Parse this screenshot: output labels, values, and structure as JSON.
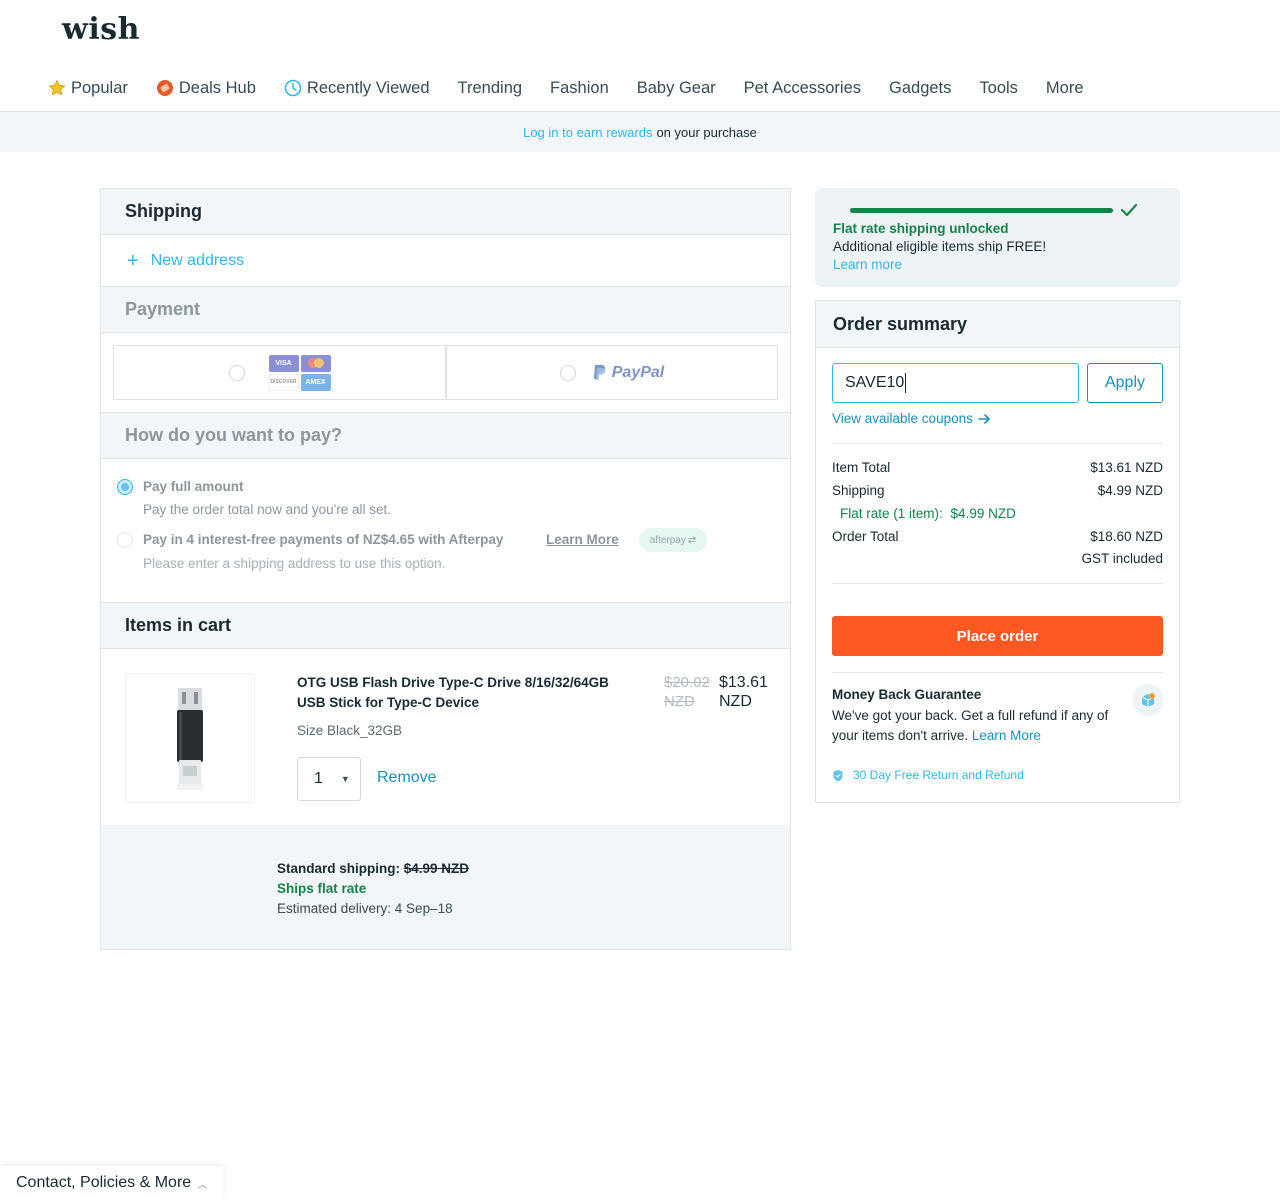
{
  "header": {
    "logo": "wish",
    "nav": [
      {
        "label": "Popular",
        "icon": "star-icon"
      },
      {
        "label": "Deals Hub",
        "icon": "deals-tag-icon"
      },
      {
        "label": "Recently Viewed",
        "icon": "clock-icon"
      },
      {
        "label": "Trending"
      },
      {
        "label": "Fashion"
      },
      {
        "label": "Baby Gear"
      },
      {
        "label": "Pet Accessories"
      },
      {
        "label": "Gadgets"
      },
      {
        "label": "Tools"
      },
      {
        "label": "More"
      }
    ]
  },
  "banner": {
    "link": "Log in to earn rewards",
    "rest": "on your purchase"
  },
  "shipping": {
    "title": "Shipping",
    "new_address": "New address"
  },
  "payment": {
    "title": "Payment",
    "cards": [
      "VISA",
      "MC",
      "DISCOVER",
      "AMEX"
    ],
    "paypal": "PayPal"
  },
  "how_pay": {
    "title": "How do you want to pay?",
    "full_title": "Pay full amount",
    "full_sub": "Pay the order total now and you're all set.",
    "afterpay_title": "Pay in 4 interest-free payments of NZ$4.65 with Afterpay",
    "afterpay_learn": "Learn More",
    "afterpay_badge": "afterpay",
    "afterpay_sub": "Please enter a shipping address to use this option."
  },
  "cart": {
    "title": "Items in cart",
    "item_name": "OTG USB Flash Drive Type-C Drive 8/16/32/64GB USB Stick for Type-C Device",
    "old_price_1": "$20.02",
    "old_price_2": "NZD",
    "price_1": "$13.61",
    "price_2": "NZD",
    "size": "Size Black_32GB",
    "qty": "1",
    "remove": "Remove",
    "ship_label": "Standard shipping:",
    "ship_old": "$4.99 NZD",
    "ship_flat": "Ships flat rate",
    "delivery": "Estimated delivery: 4 Sep–18"
  },
  "unlock": {
    "progress": 1.0,
    "title": "Flat rate shipping unlocked",
    "text": "Additional eligible items ship FREE!",
    "link": "Learn more"
  },
  "summary": {
    "title": "Order summary",
    "coupon_value": "SAVE10",
    "apply": "Apply",
    "view_coupons": "View available coupons",
    "item_total_label": "Item Total",
    "item_total": "$13.61 NZD",
    "shipping_label": "Shipping",
    "shipping": "$4.99 NZD",
    "flat_label": "Flat rate (1 item):",
    "flat_value": "$4.99 NZD",
    "order_total_label": "Order Total",
    "order_total": "$18.60 NZD",
    "gst": "GST included",
    "place_order": "Place order",
    "mbg_title": "Money Back Guarantee",
    "mbg_text": "We've got your back. Get a full refund if any of your items don't arrive.",
    "mbg_link": "Learn More",
    "return_text": "30 Day Free Return and Refund"
  },
  "footer": {
    "label": "Contact, Policies & More"
  },
  "colors": {
    "accent": "#2fb7ec",
    "link_dark": "#1c8fb8",
    "green": "#13834a",
    "cta": "#ff5722"
  }
}
